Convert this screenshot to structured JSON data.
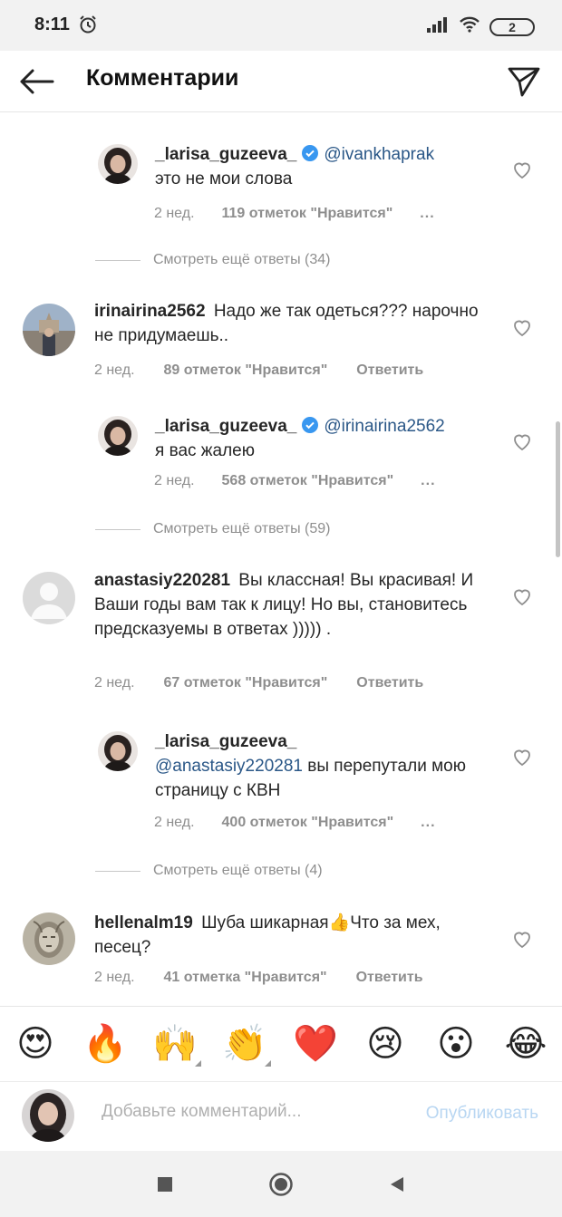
{
  "status": {
    "time": "8:11",
    "battery": "2"
  },
  "header": {
    "title": "Комментарии"
  },
  "comments": [
    {
      "kind": "reply",
      "username": "_larisa_guzeeva_",
      "mention": "@ivankhaprak",
      "text": "это не мои слова",
      "time": "2 нед.",
      "likes": "119 отметок \"Нравится\"",
      "more": "..."
    },
    {
      "kind": "view_more",
      "label": "Смотреть ещё ответы (34)"
    },
    {
      "kind": "comment",
      "username": "irinairina2562",
      "text": "Надо же так одеться??? нарочно не придумаешь..",
      "time": "2 нед.",
      "likes": "89 отметок \"Нравится\"",
      "reply": "Ответить"
    },
    {
      "kind": "reply",
      "username": "_larisa_guzeeva_",
      "mention": "@irinairina2562",
      "text": "я вас жалею",
      "time": "2 нед.",
      "likes": "568 отметок \"Нравится\"",
      "more": "..."
    },
    {
      "kind": "view_more",
      "label": "Смотреть ещё ответы (59)"
    },
    {
      "kind": "comment",
      "username": "anastasiy220281",
      "text": "Вы классная! Вы красивая! И Ваши годы вам так к лицу! Но вы, становитесь предсказуемы в ответах ))))) .",
      "time": "2 нед.",
      "likes": "67 отметок \"Нравится\"",
      "reply": "Ответить"
    },
    {
      "kind": "reply",
      "username": "_larisa_guzeeva_",
      "mention": "@anastasiy220281",
      "text": "вы перепутали мою страницу с КВН",
      "time": "2 нед.",
      "likes": "400 отметок \"Нравится\"",
      "more": "..."
    },
    {
      "kind": "view_more",
      "label": "Смотреть ещё ответы (4)"
    },
    {
      "kind": "comment",
      "username": "hellenalm19",
      "text": "Шуба шикарная👍Что за мех, песец?",
      "time": "2 нед.",
      "likes": "41 отметка \"Нравится\"",
      "reply": "Ответить"
    }
  ],
  "emojis": [
    "😍",
    "🔥",
    "🙌",
    "👏",
    "❤️",
    "😢",
    "😮",
    "😂"
  ],
  "compose": {
    "placeholder": "Добавьте комментарий...",
    "publish": "Опубликовать"
  },
  "colors": {
    "link": "#2a5787",
    "verified": "#3897f0",
    "muted": "#8e8e8e",
    "publish_disabled": "#b8d6f2"
  }
}
